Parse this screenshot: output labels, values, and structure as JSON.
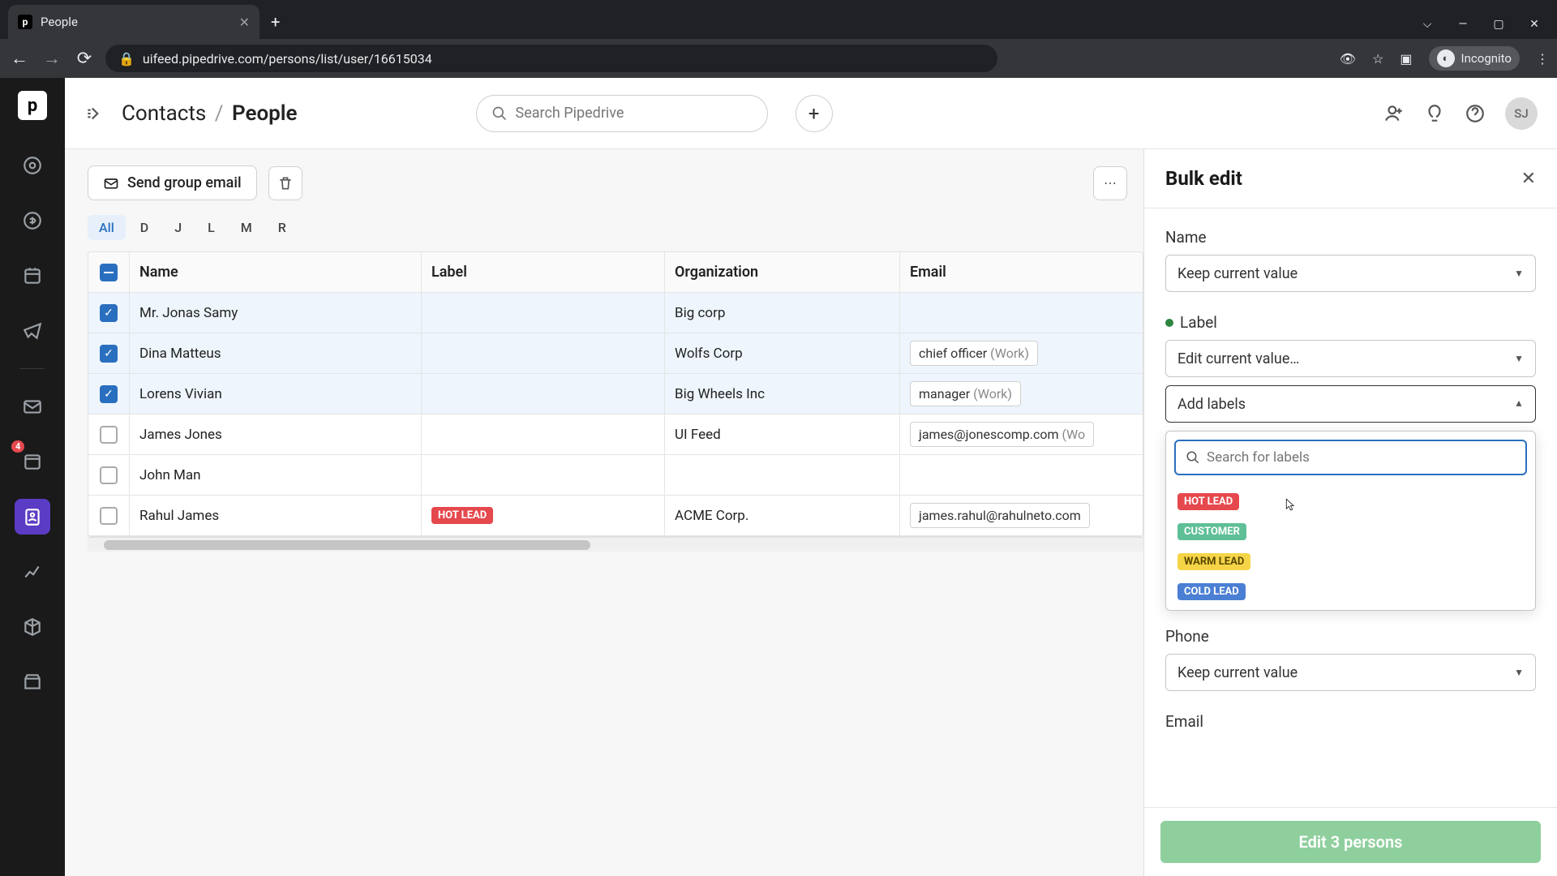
{
  "browser": {
    "tab_title": "People",
    "url": "uifeed.pipedrive.com/persons/list/user/16615034",
    "incognito": "Incognito"
  },
  "header": {
    "breadcrumb_parent": "Contacts",
    "breadcrumb_current": "People",
    "search_placeholder": "Search Pipedrive",
    "avatar_initials": "SJ"
  },
  "toolbar": {
    "send_email": "Send group email"
  },
  "alpha_tabs": [
    "All",
    "D",
    "J",
    "L",
    "M",
    "R"
  ],
  "table": {
    "columns": {
      "name": "Name",
      "label": "Label",
      "org": "Organization",
      "email": "Email"
    },
    "rows": [
      {
        "selected": true,
        "name": "Mr. Jonas Samy",
        "label": null,
        "org": "Big corp",
        "email": null
      },
      {
        "selected": true,
        "name": "Dina Matteus",
        "label": null,
        "org": "Wolfs Corp",
        "email": "chief officer",
        "email_type": "(Work)"
      },
      {
        "selected": true,
        "name": "Lorens Vivian",
        "label": null,
        "org": "Big Wheels Inc",
        "email": "manager",
        "email_type": "(Work)"
      },
      {
        "selected": false,
        "name": "James Jones",
        "label": null,
        "org": "UI Feed",
        "email": "james@jonescomp.com",
        "email_type": "(Wo"
      },
      {
        "selected": false,
        "name": "John Man",
        "label": null,
        "org": "",
        "email": null
      },
      {
        "selected": false,
        "name": "Rahul James",
        "label": "HOT LEAD",
        "label_color": "hot",
        "org": "ACME Corp.",
        "email": "james.rahul@rahulneto.com",
        "email_type": ""
      }
    ]
  },
  "panel": {
    "title": "Bulk edit",
    "fields": {
      "name_label": "Name",
      "name_value": "Keep current value",
      "label_label": "Label",
      "label_value": "Edit current value…",
      "add_labels": "Add labels",
      "search_placeholder": "Search for labels",
      "phone_label": "Phone",
      "phone_value": "Keep current value",
      "email_label": "Email"
    },
    "label_options": [
      {
        "text": "HOT LEAD",
        "cls": "hot"
      },
      {
        "text": "CUSTOMER",
        "cls": "customer"
      },
      {
        "text": "WARM LEAD",
        "cls": "warm"
      },
      {
        "text": "COLD LEAD",
        "cls": "cold"
      }
    ],
    "submit": "Edit 3 persons"
  },
  "sidebar_badge": "4"
}
